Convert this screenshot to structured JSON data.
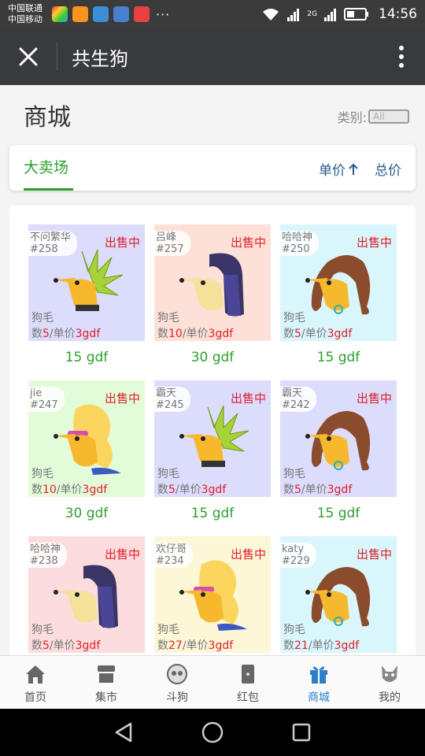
{
  "status_bar": {
    "carrier_1": "中国联通",
    "carrier_2": "中国移动",
    "overflow": "···",
    "net": "2G",
    "time": "14:56"
  },
  "appbar": {
    "title": "共生狗"
  },
  "page": {
    "title": "商城",
    "category_label": "类别:",
    "category_value": "All"
  },
  "tabs": {
    "main": "大卖场",
    "sort_unit": "单价",
    "sort_total": "总价"
  },
  "listings": [
    {
      "owner": "不问繁华",
      "id": "#258",
      "status": "出售中",
      "type": "狗毛",
      "count_label": "数",
      "count": "5",
      "unit_label": "/单价",
      "unit_price": "3gdf",
      "price": "15 gdf",
      "bg": "#dcdcfc",
      "style": "spiky"
    },
    {
      "owner": "吕峰",
      "id": "#257",
      "status": "出售中",
      "type": "狗毛",
      "count_label": "数",
      "count": "10",
      "unit_label": "/单价",
      "unit_price": "3gdf",
      "price": "30 gdf",
      "bg": "#fde1d8",
      "style": "longhair"
    },
    {
      "owner": "哈哈神",
      "id": "#250",
      "status": "出售中",
      "type": "狗毛",
      "count_label": "数",
      "count": "5",
      "unit_label": "/单价",
      "unit_price": "3gdf",
      "price": "15 gdf",
      "bg": "#d8f6fc",
      "style": "curly"
    },
    {
      "owner": "jie",
      "id": "#247",
      "status": "出售中",
      "type": "狗毛",
      "count_label": "数",
      "count": "10",
      "unit_label": "/单价",
      "unit_price": "3gdf",
      "price": "30 gdf",
      "bg": "#e2fcd9",
      "style": "blonde"
    },
    {
      "owner": "霸天",
      "id": "#245",
      "status": "出售中",
      "type": "狗毛",
      "count_label": "数",
      "count": "5",
      "unit_label": "/单价",
      "unit_price": "3gdf",
      "price": "15 gdf",
      "bg": "#dcdcfc",
      "style": "spiky"
    },
    {
      "owner": "霸天",
      "id": "#242",
      "status": "出售中",
      "type": "狗毛",
      "count_label": "数",
      "count": "5",
      "unit_label": "/单价",
      "unit_price": "3gdf",
      "price": "15 gdf",
      "bg": "#dcdcfc",
      "style": "curly"
    },
    {
      "owner": "哈哈神",
      "id": "#238",
      "status": "出售中",
      "type": "狗毛",
      "count_label": "数",
      "count": "5",
      "unit_label": "/单价",
      "unit_price": "3gdf",
      "price": "",
      "bg": "#fcdcdc",
      "style": "longhair"
    },
    {
      "owner": "欢仔哥",
      "id": "#234",
      "status": "出售中",
      "type": "狗毛",
      "count_label": "数",
      "count": "27",
      "unit_label": "/单价",
      "unit_price": "3gdf",
      "price": "",
      "bg": "#fdf7d8",
      "style": "blonde"
    },
    {
      "owner": "katy",
      "id": "#229",
      "status": "出售中",
      "type": "狗毛",
      "count_label": "数",
      "count": "21",
      "unit_label": "/单价",
      "unit_price": "3gdf",
      "price": "",
      "bg": "#d8f6fc",
      "style": "curly"
    }
  ],
  "bottom_nav": [
    {
      "label": "首页",
      "icon": "home-icon",
      "active": false
    },
    {
      "label": "集市",
      "icon": "market-stall-icon",
      "active": false
    },
    {
      "label": "斗狗",
      "icon": "dogfight-icon",
      "active": false
    },
    {
      "label": "红包",
      "icon": "red-packet-icon",
      "active": false
    },
    {
      "label": "商城",
      "icon": "gift-box-icon",
      "active": true
    },
    {
      "label": "我的",
      "icon": "profile-dog-icon",
      "active": false
    }
  ],
  "colors": {
    "accent_green": "#2ea02e",
    "sale_red": "#e0202a",
    "active_blue": "#2f7fc8",
    "appbar": "#393a3d"
  }
}
